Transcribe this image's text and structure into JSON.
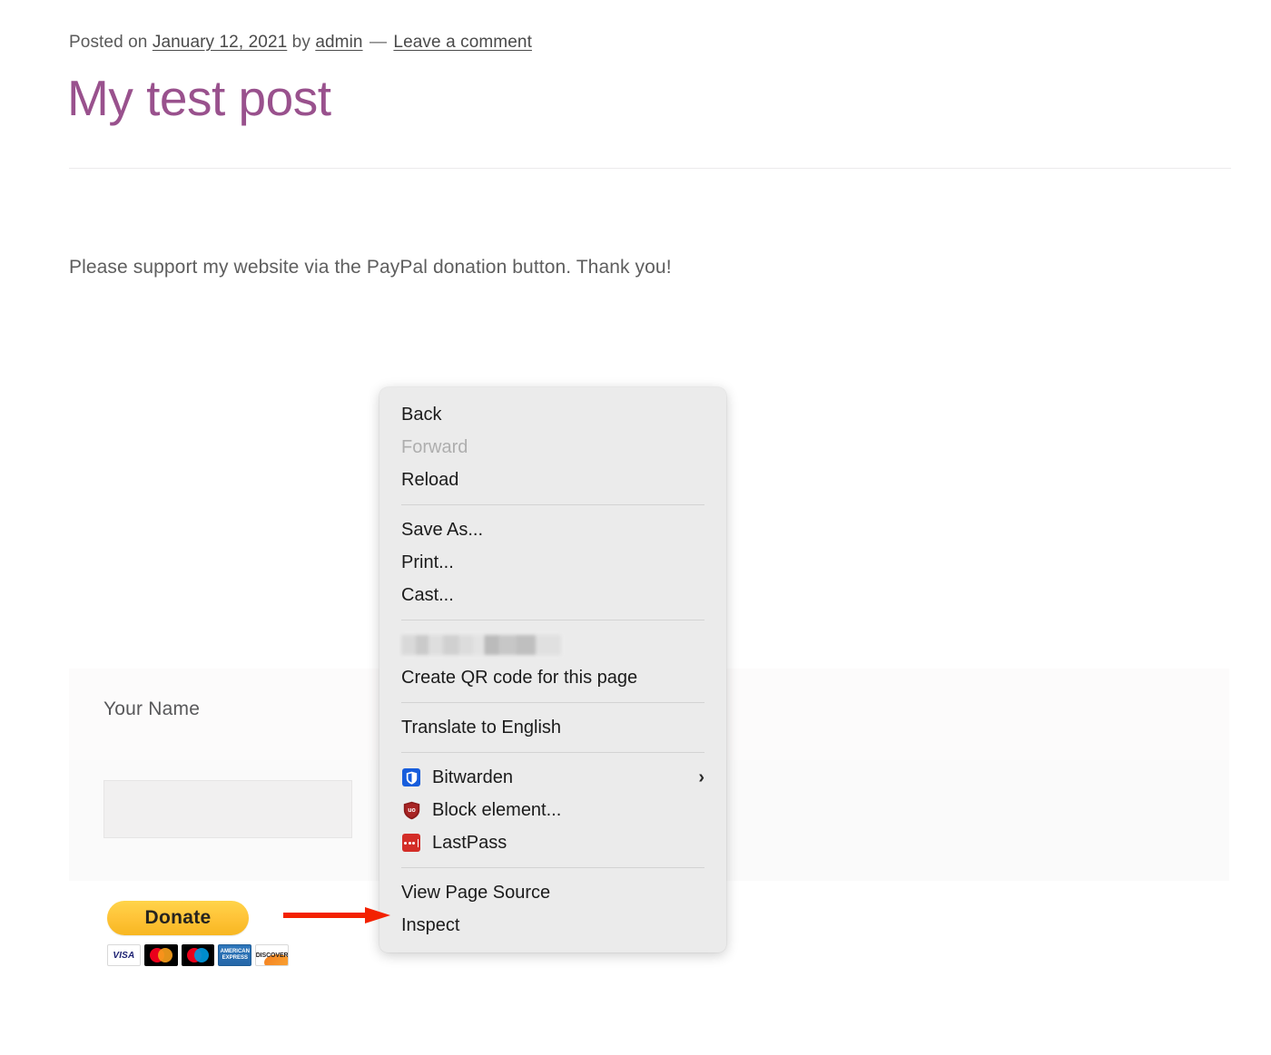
{
  "post": {
    "meta_prefix": "Posted on ",
    "date": "January 12, 2021",
    "by_text": " by ",
    "author": "admin",
    "separator": " — ",
    "comment_link": "Leave a comment",
    "title": "My test post",
    "body": "Please support my website via the PayPal donation button. Thank you!"
  },
  "donation_form": {
    "name_label": "Your Name",
    "name_value": "",
    "name_placeholder": "",
    "donate_button_label": "Donate",
    "cards": [
      {
        "name": "visa-card-icon",
        "label": "VISA"
      },
      {
        "name": "mastercard-card-icon",
        "label": ""
      },
      {
        "name": "maestro-card-icon",
        "label": ""
      },
      {
        "name": "amex-card-icon",
        "label": "AMERICAN EXPRESS"
      },
      {
        "name": "discover-card-icon",
        "label": "DISCOVER"
      }
    ]
  },
  "context_menu": {
    "items": [
      {
        "id": "back",
        "label": "Back",
        "type": "item",
        "disabled": false
      },
      {
        "id": "forward",
        "label": "Forward",
        "type": "item",
        "disabled": true
      },
      {
        "id": "reload",
        "label": "Reload",
        "type": "item",
        "disabled": false
      },
      {
        "id": "sep1",
        "label": "",
        "type": "separator",
        "disabled": false
      },
      {
        "id": "save-as",
        "label": "Save As...",
        "type": "item",
        "disabled": false
      },
      {
        "id": "print",
        "label": "Print...",
        "type": "item",
        "disabled": false
      },
      {
        "id": "cast",
        "label": "Cast...",
        "type": "item",
        "disabled": false
      },
      {
        "id": "sep2",
        "label": "",
        "type": "separator",
        "disabled": false
      },
      {
        "id": "redacted",
        "label": "",
        "type": "redacted",
        "disabled": false
      },
      {
        "id": "create-qr",
        "label": "Create QR code for this page",
        "type": "item",
        "disabled": false
      },
      {
        "id": "sep3",
        "label": "",
        "type": "separator",
        "disabled": false
      },
      {
        "id": "translate",
        "label": "Translate to English",
        "type": "item",
        "disabled": false
      },
      {
        "id": "sep4",
        "label": "",
        "type": "separator",
        "disabled": false
      },
      {
        "id": "bitwarden",
        "label": "Bitwarden",
        "type": "item",
        "disabled": false,
        "icon": "bitwarden-icon",
        "submenu": true
      },
      {
        "id": "block-element",
        "label": "Block element...",
        "type": "item",
        "disabled": false,
        "icon": "ublock-origin-icon"
      },
      {
        "id": "lastpass",
        "label": "LastPass",
        "type": "item",
        "disabled": false,
        "icon": "lastpass-icon"
      },
      {
        "id": "sep5",
        "label": "",
        "type": "separator",
        "disabled": false
      },
      {
        "id": "view-source",
        "label": "View Page Source",
        "type": "item",
        "disabled": false
      },
      {
        "id": "inspect",
        "label": "Inspect",
        "type": "item",
        "disabled": false
      }
    ],
    "submenu_chevron": "›"
  },
  "annotation": {
    "arrow_color": "#f32100",
    "points_at": "Inspect"
  },
  "colors": {
    "title_purple": "#99518d",
    "menu_bg": "#ebebeb",
    "paypal_yellow": "#ffc439",
    "arrow_red": "#f32100"
  }
}
